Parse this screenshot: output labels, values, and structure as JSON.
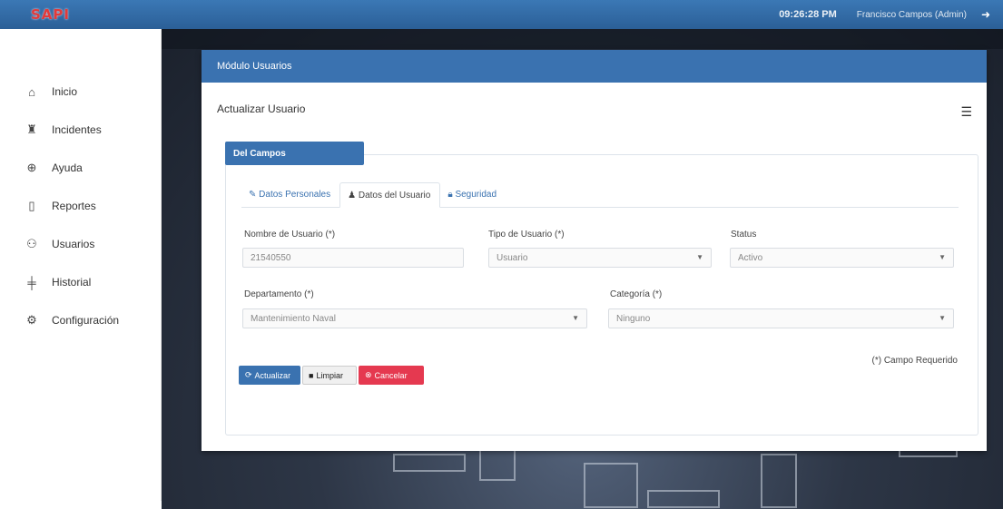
{
  "app": {
    "logo": "SAPI"
  },
  "topbar": {
    "clock": "09:26:28 PM",
    "user": "Francisco Campos (Admin)",
    "logout_icon": "logout-icon"
  },
  "sidebar": {
    "items": [
      {
        "label": "Inicio",
        "icon": "home-icon"
      },
      {
        "label": "Incidentes",
        "icon": "incidents-icon"
      },
      {
        "label": "Ayuda",
        "icon": "help-icon"
      },
      {
        "label": "Reportes",
        "icon": "reports-icon"
      },
      {
        "label": "Usuarios",
        "icon": "users-icon"
      },
      {
        "label": "Historial",
        "icon": "history-icon"
      },
      {
        "label": "Configuración",
        "icon": "gear-icon"
      }
    ]
  },
  "module": {
    "header": "Módulo Usuarios",
    "subtitle": "Actualizar Usuario",
    "list_icon": "list-icon",
    "fieldset_title": "Del Campos",
    "tabs": [
      {
        "label": "Datos Personales",
        "icon": "edit-icon",
        "active": false
      },
      {
        "label": "Datos del Usuario",
        "icon": "user-icon",
        "active": true
      },
      {
        "label": "Seguridad",
        "icon": "lock-icon",
        "active": false
      }
    ],
    "fields": {
      "username": {
        "label": "Nombre de Usuario (*)",
        "value": "21540550"
      },
      "user_type": {
        "label": "Tipo de Usuario (*)",
        "value": "Usuario"
      },
      "status": {
        "label": "Status",
        "value": "Activo"
      },
      "department": {
        "label": "Departamento (*)",
        "value": "Mantenimiento Naval"
      },
      "category": {
        "label": "Categoría (*)",
        "value": "Ninguno"
      }
    },
    "required_note": "(*) Campo Requerido",
    "buttons": {
      "update": "Actualizar",
      "clear": "Limpiar",
      "cancel": "Cancelar"
    }
  },
  "colors": {
    "primary": "#3a72b0",
    "danger": "#e53950"
  }
}
